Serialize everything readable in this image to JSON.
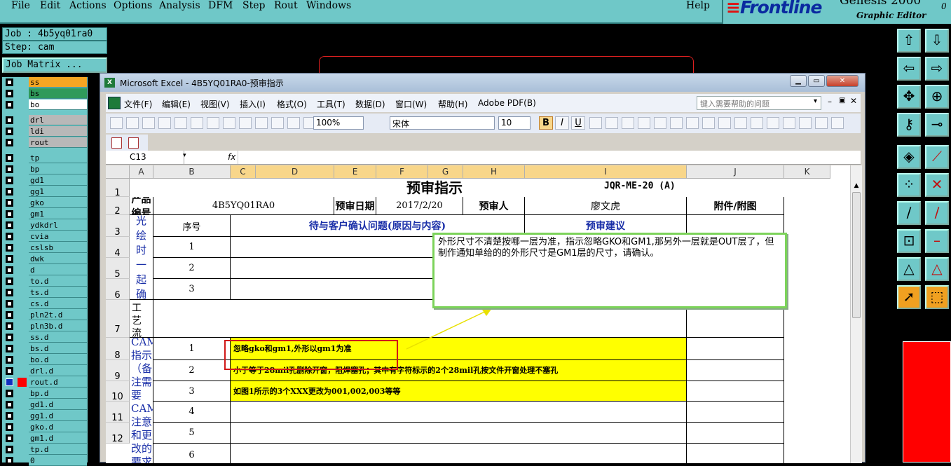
{
  "genesis": {
    "menu": [
      "File",
      "Edit",
      "Actions",
      "Options",
      "Analysis",
      "DFM",
      "Step",
      "Rout",
      "Windows"
    ],
    "help": "Help",
    "brand_logo": "Frontline",
    "brand_title": "Genesis 2000",
    "brand_sub": "Graphic Editor",
    "brand_cut": "0",
    "job": "Job : 4b5yq01ra0",
    "step": "Step: cam",
    "job_matrix": "Job Matrix ...",
    "layers": [
      {
        "name": "ss",
        "style": "orange",
        "mark": "pencil"
      },
      {
        "name": "bs",
        "style": "green",
        "mark": ""
      },
      {
        "name": "bo",
        "style": "white",
        "mark": ""
      },
      {
        "name": "drl",
        "style": "gray",
        "mark": ""
      },
      {
        "name": "ldi",
        "style": "gray",
        "mark": ""
      },
      {
        "name": "rout",
        "style": "gray",
        "mark": ""
      },
      {
        "name": "tp",
        "style": "cyan",
        "mark": ""
      },
      {
        "name": "bp",
        "style": "cyan",
        "mark": ""
      },
      {
        "name": "gd1",
        "style": "cyan",
        "mark": "pencil"
      },
      {
        "name": "gg1",
        "style": "cyan",
        "mark": ""
      },
      {
        "name": "gko",
        "style": "cyan",
        "mark": "pencil"
      },
      {
        "name": "gm1",
        "style": "cyan",
        "mark": ""
      },
      {
        "name": "ydkdrl",
        "style": "cyan",
        "mark": ""
      },
      {
        "name": "cvia",
        "style": "cyan",
        "mark": ""
      },
      {
        "name": "cslsb",
        "style": "cyan",
        "mark": ""
      },
      {
        "name": "dwk",
        "style": "cyan",
        "mark": ""
      },
      {
        "name": "d",
        "style": "cyan",
        "mark": ""
      },
      {
        "name": "to.d",
        "style": "cyan",
        "mark": "pencil"
      },
      {
        "name": "ts.d",
        "style": "cyan",
        "mark": ""
      },
      {
        "name": "cs.d",
        "style": "cyan",
        "mark": "pencil"
      },
      {
        "name": "pln2t.d",
        "style": "cyan",
        "mark": ""
      },
      {
        "name": "pln3b.d",
        "style": "cyan",
        "mark": ""
      },
      {
        "name": "ss.d",
        "style": "cyan",
        "mark": "pencil"
      },
      {
        "name": "bs.d",
        "style": "cyan",
        "mark": ""
      },
      {
        "name": "bo.d",
        "style": "cyan",
        "mark": ""
      },
      {
        "name": "drl.d",
        "style": "cyan",
        "mark": ""
      },
      {
        "name": "rout.d",
        "style": "cyan",
        "mark": "grid",
        "active": true
      },
      {
        "name": "bp.d",
        "style": "cyan",
        "mark": ""
      },
      {
        "name": "gd1.d",
        "style": "cyan",
        "mark": "pencil"
      },
      {
        "name": "gg1.d",
        "style": "cyan",
        "mark": ""
      },
      {
        "name": "gko.d",
        "style": "cyan",
        "mark": "pencil"
      },
      {
        "name": "gm1.d",
        "style": "cyan",
        "mark": ""
      },
      {
        "name": "tp.d",
        "style": "cyan",
        "mark": ""
      },
      {
        "name": "0",
        "style": "cyan",
        "mark": ""
      }
    ],
    "tools": [
      "move-up-icon",
      "move-down-icon",
      "move-left-icon",
      "move-right-icon",
      "expand-icon",
      "center-icon",
      "measure-icon",
      "slider-icon",
      "snap-icon",
      "line-tool-icon",
      "node-icon",
      "cross-icon",
      "slope-icon",
      "slope-alt-icon",
      "pad-icon",
      "minus-icon",
      "triangle-icon",
      "triangle-alt-icon",
      "pointer-icon",
      "pointer-box-icon"
    ],
    "colors": {
      "panel": "#6fc8c8",
      "active_layer": "#ff0000"
    }
  },
  "excel": {
    "title": "Microsoft Excel - 4B5YQ01RA0-预审指示",
    "menu": [
      "文件(F)",
      "编辑(E)",
      "视图(V)",
      "插入(I)",
      "格式(O)",
      "工具(T)",
      "数据(D)",
      "窗口(W)",
      "帮助(H)",
      "Adobe PDF(B)"
    ],
    "help_placeholder": "键入需要帮助的问题",
    "zoom": "100%",
    "font": "宋体",
    "size": "10",
    "cell_ref": "C13",
    "fx": "fx",
    "cols": [
      "A",
      "B",
      "C",
      "D",
      "E",
      "F",
      "G",
      "H",
      "I",
      "J",
      "K"
    ],
    "rows": [
      "1",
      "2",
      "3",
      "4",
      "5",
      "6",
      "7",
      "8",
      "9",
      "10",
      "11",
      "12"
    ],
    "sheet": {
      "title": "预审指示",
      "doc_no": "JQR-ME-20 (A)",
      "product_label": "产品编号",
      "product_no": "4B5YQ01RA0",
      "date_label": "预审日期",
      "date": "2017/2/20",
      "reviewer_label": "预审人",
      "reviewer": "廖文虎",
      "attach_label": "附件/附图",
      "seq_label": "序号",
      "issue_header": "待与客户确认问题(原因与内容)",
      "suggest_header": "预审建议",
      "group1": "待确认光绘时一起确认问题",
      "group2": "工艺流程指示（备注工艺评审后的流程要求）",
      "group3": "CAM指示（备注需要CAM注意和更改的要求）",
      "seq": [
        "1",
        "2",
        "3",
        "1",
        "2",
        "3",
        "4",
        "5",
        "6"
      ],
      "cam1": "忽略gko和gm1,外形以gm1为准",
      "cam2": "小于等于28mil孔删除开窗，阻焊塞孔；其中有字符标示的2个28mil孔按文件开窗处理不塞孔",
      "cam3": "如图1所示的3个XXX更改为001,002,003等等"
    },
    "comment": "外形尺寸不清楚按哪一层为准，指示忽略GKO和GM1,那另外一层就是OUT层了，但制作通知单给的的外形尺寸是GM1层的尺寸，请确认。"
  }
}
